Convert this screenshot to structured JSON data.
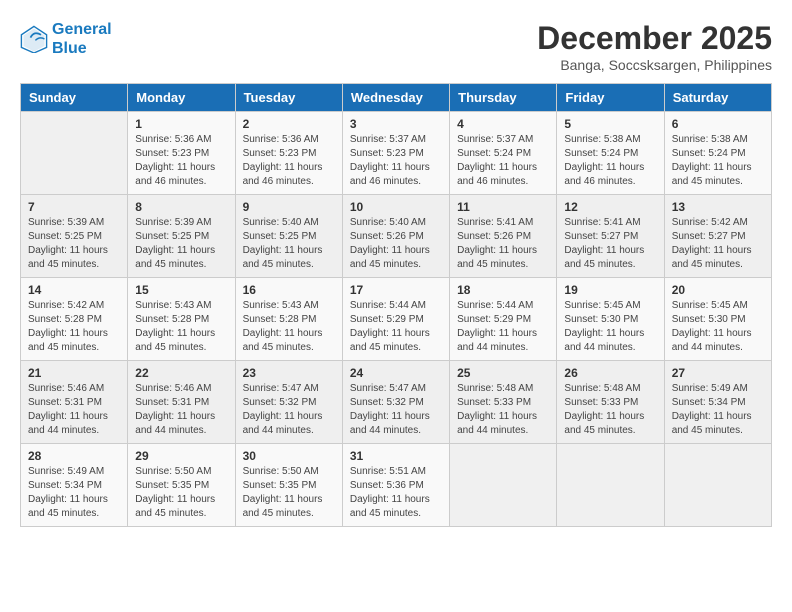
{
  "header": {
    "logo_line1": "General",
    "logo_line2": "Blue",
    "month": "December 2025",
    "location": "Banga, Soccsksargen, Philippines"
  },
  "days_of_week": [
    "Sunday",
    "Monday",
    "Tuesday",
    "Wednesday",
    "Thursday",
    "Friday",
    "Saturday"
  ],
  "weeks": [
    [
      {
        "day": "",
        "info": ""
      },
      {
        "day": "1",
        "info": "Sunrise: 5:36 AM\nSunset: 5:23 PM\nDaylight: 11 hours and 46 minutes."
      },
      {
        "day": "2",
        "info": "Sunrise: 5:36 AM\nSunset: 5:23 PM\nDaylight: 11 hours and 46 minutes."
      },
      {
        "day": "3",
        "info": "Sunrise: 5:37 AM\nSunset: 5:23 PM\nDaylight: 11 hours and 46 minutes."
      },
      {
        "day": "4",
        "info": "Sunrise: 5:37 AM\nSunset: 5:24 PM\nDaylight: 11 hours and 46 minutes."
      },
      {
        "day": "5",
        "info": "Sunrise: 5:38 AM\nSunset: 5:24 PM\nDaylight: 11 hours and 46 minutes."
      },
      {
        "day": "6",
        "info": "Sunrise: 5:38 AM\nSunset: 5:24 PM\nDaylight: 11 hours and 45 minutes."
      }
    ],
    [
      {
        "day": "7",
        "info": "Sunrise: 5:39 AM\nSunset: 5:25 PM\nDaylight: 11 hours and 45 minutes."
      },
      {
        "day": "8",
        "info": "Sunrise: 5:39 AM\nSunset: 5:25 PM\nDaylight: 11 hours and 45 minutes."
      },
      {
        "day": "9",
        "info": "Sunrise: 5:40 AM\nSunset: 5:25 PM\nDaylight: 11 hours and 45 minutes."
      },
      {
        "day": "10",
        "info": "Sunrise: 5:40 AM\nSunset: 5:26 PM\nDaylight: 11 hours and 45 minutes."
      },
      {
        "day": "11",
        "info": "Sunrise: 5:41 AM\nSunset: 5:26 PM\nDaylight: 11 hours and 45 minutes."
      },
      {
        "day": "12",
        "info": "Sunrise: 5:41 AM\nSunset: 5:27 PM\nDaylight: 11 hours and 45 minutes."
      },
      {
        "day": "13",
        "info": "Sunrise: 5:42 AM\nSunset: 5:27 PM\nDaylight: 11 hours and 45 minutes."
      }
    ],
    [
      {
        "day": "14",
        "info": "Sunrise: 5:42 AM\nSunset: 5:28 PM\nDaylight: 11 hours and 45 minutes."
      },
      {
        "day": "15",
        "info": "Sunrise: 5:43 AM\nSunset: 5:28 PM\nDaylight: 11 hours and 45 minutes."
      },
      {
        "day": "16",
        "info": "Sunrise: 5:43 AM\nSunset: 5:28 PM\nDaylight: 11 hours and 45 minutes."
      },
      {
        "day": "17",
        "info": "Sunrise: 5:44 AM\nSunset: 5:29 PM\nDaylight: 11 hours and 45 minutes."
      },
      {
        "day": "18",
        "info": "Sunrise: 5:44 AM\nSunset: 5:29 PM\nDaylight: 11 hours and 44 minutes."
      },
      {
        "day": "19",
        "info": "Sunrise: 5:45 AM\nSunset: 5:30 PM\nDaylight: 11 hours and 44 minutes."
      },
      {
        "day": "20",
        "info": "Sunrise: 5:45 AM\nSunset: 5:30 PM\nDaylight: 11 hours and 44 minutes."
      }
    ],
    [
      {
        "day": "21",
        "info": "Sunrise: 5:46 AM\nSunset: 5:31 PM\nDaylight: 11 hours and 44 minutes."
      },
      {
        "day": "22",
        "info": "Sunrise: 5:46 AM\nSunset: 5:31 PM\nDaylight: 11 hours and 44 minutes."
      },
      {
        "day": "23",
        "info": "Sunrise: 5:47 AM\nSunset: 5:32 PM\nDaylight: 11 hours and 44 minutes."
      },
      {
        "day": "24",
        "info": "Sunrise: 5:47 AM\nSunset: 5:32 PM\nDaylight: 11 hours and 44 minutes."
      },
      {
        "day": "25",
        "info": "Sunrise: 5:48 AM\nSunset: 5:33 PM\nDaylight: 11 hours and 44 minutes."
      },
      {
        "day": "26",
        "info": "Sunrise: 5:48 AM\nSunset: 5:33 PM\nDaylight: 11 hours and 45 minutes."
      },
      {
        "day": "27",
        "info": "Sunrise: 5:49 AM\nSunset: 5:34 PM\nDaylight: 11 hours and 45 minutes."
      }
    ],
    [
      {
        "day": "28",
        "info": "Sunrise: 5:49 AM\nSunset: 5:34 PM\nDaylight: 11 hours and 45 minutes."
      },
      {
        "day": "29",
        "info": "Sunrise: 5:50 AM\nSunset: 5:35 PM\nDaylight: 11 hours and 45 minutes."
      },
      {
        "day": "30",
        "info": "Sunrise: 5:50 AM\nSunset: 5:35 PM\nDaylight: 11 hours and 45 minutes."
      },
      {
        "day": "31",
        "info": "Sunrise: 5:51 AM\nSunset: 5:36 PM\nDaylight: 11 hours and 45 minutes."
      },
      {
        "day": "",
        "info": ""
      },
      {
        "day": "",
        "info": ""
      },
      {
        "day": "",
        "info": ""
      }
    ]
  ]
}
